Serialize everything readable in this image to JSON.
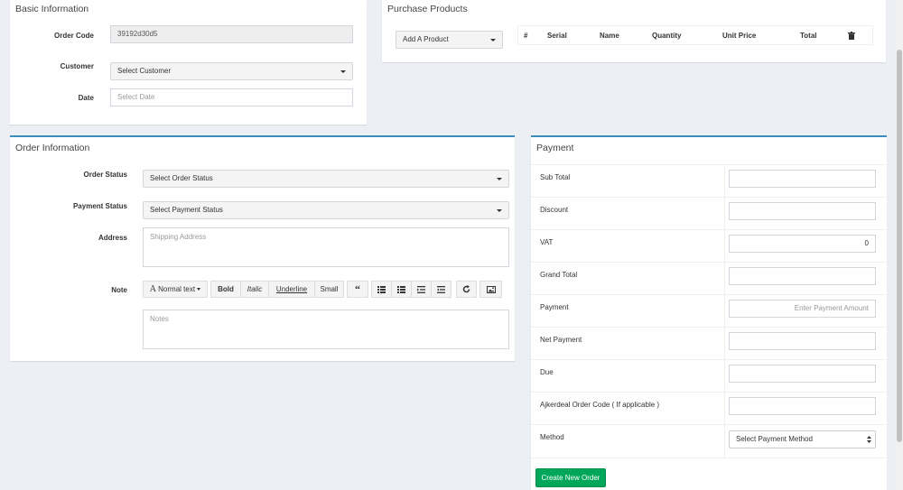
{
  "basic": {
    "title": "Basic Information",
    "order_code_label": "Order Code",
    "order_code_value": "39192d30d5",
    "customer_label": "Customer",
    "customer_value": "Select Customer",
    "date_label": "Date",
    "date_placeholder": "Select Date"
  },
  "purchase": {
    "title": "Purchase Products",
    "add_product": "Add A Product",
    "columns": [
      "#",
      "Serial",
      "Name",
      "Quantity",
      "Unit Price",
      "Total"
    ],
    "trash_icon": "trash-icon"
  },
  "order": {
    "title": "Order Information",
    "order_status_label": "Order Status",
    "order_status_value": "Select Order Status",
    "payment_status_label": "Payment Status",
    "payment_status_value": "Select Payment Status",
    "address_label": "Address",
    "address_placeholder": "Shipping Address",
    "note_label": "Note",
    "toolbar": {
      "font_glyph": "A",
      "normal_text": "Normal text",
      "bold": "Bold",
      "italic": "Italic",
      "underline": "Underline",
      "small": "Small",
      "quote_glyph": "“"
    },
    "notes_placeholder": "Notes"
  },
  "payment": {
    "title": "Payment",
    "rows": [
      {
        "label": "Sub Total",
        "value": ""
      },
      {
        "label": "Discount",
        "value": ""
      },
      {
        "label": "VAT",
        "value": "0"
      },
      {
        "label": "Grand Total",
        "value": ""
      },
      {
        "label": "Payment",
        "value": "Enter Payment Amount"
      },
      {
        "label": "Net Payment",
        "value": ""
      },
      {
        "label": "Due",
        "value": ""
      },
      {
        "label": "Ajkerdeal Order Code ( If applicable )",
        "value": ""
      }
    ],
    "method_label": "Method",
    "method_value": "Select Payment Method",
    "create_button": "Create New Order",
    "accent": "#00a65a"
  }
}
